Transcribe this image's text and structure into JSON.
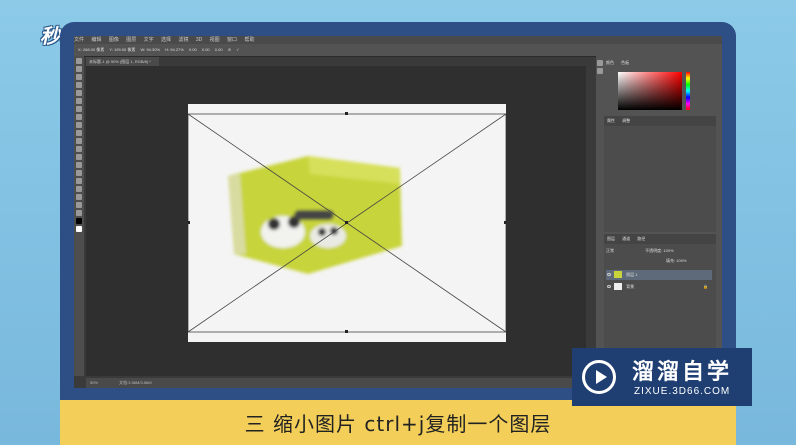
{
  "branding": {
    "logo_text": "秒dong视频"
  },
  "caption": "三 缩小图片 ctrl+j复制一个图层",
  "watermark": {
    "title": "溜溜自学",
    "url": "ZIXUE.3D66.COM"
  },
  "photoshop": {
    "menu_items": [
      "文件",
      "编辑",
      "图像",
      "图层",
      "文字",
      "选择",
      "滤镜",
      "3D",
      "视图",
      "窗口",
      "帮助"
    ],
    "options_bar": [
      "X: 268.00 像素",
      "Y: 199.00 像素",
      "W: 94.30%",
      "H: 94.27%",
      "0.00",
      "0.00",
      "0.00"
    ],
    "document_tab": "未标题-1 @ 50% (图层 1, RGB/8) *",
    "status_left": "50%",
    "status_mid": "文档:3.56M/3.56M",
    "color_tabs": [
      "颜色",
      "色板"
    ],
    "adjust_tabs": [
      "属性",
      "调整"
    ],
    "layers_tabs": [
      "图层",
      "通道",
      "路径"
    ],
    "layers": [
      {
        "name": "图层 1",
        "selected": true
      },
      {
        "name": "背景",
        "selected": false
      }
    ],
    "blend_mode": "正常",
    "opacity_label": "不透明度:",
    "opacity_value": "100%",
    "fill_label": "填充:",
    "fill_value": "100%"
  },
  "colors": {
    "frame": "#2e4f86",
    "caption_bar": "#f3cf5a",
    "watermark_bg": "#1f3f73",
    "product_green": "#c8d43a"
  }
}
